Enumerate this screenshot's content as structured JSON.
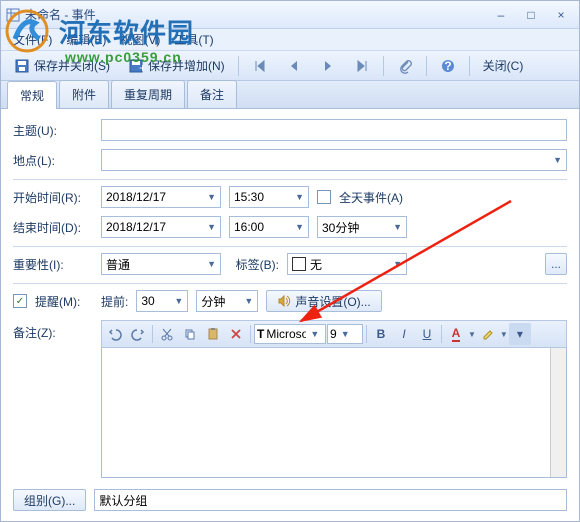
{
  "window": {
    "title": "未命名 - 事件"
  },
  "winbtns": {
    "min": "–",
    "max": "□",
    "close": "×"
  },
  "menu": {
    "file": "文件(F)",
    "edit": "编辑(E)",
    "view": "视图(V)",
    "tools": "工具(T)"
  },
  "toolbar": {
    "save_close": "保存并关闭(S)",
    "save_add": "保存并增加(N)",
    "close": "关闭(C)"
  },
  "tabs": {
    "general": "常规",
    "attach": "附件",
    "recur": "重复周期",
    "note": "备注"
  },
  "labels": {
    "subject": "主题(U):",
    "location": "地点(L):",
    "start": "开始时间(R):",
    "end": "结束时间(D):",
    "importance": "重要性(I):",
    "tag": "标签(B):",
    "remind": "提醒(M):",
    "before": "提前:",
    "memo": "备注(Z):",
    "allday": "全天事件(A)",
    "sound": "声音设置(O)...",
    "group": "组别(G)..."
  },
  "values": {
    "subject": "",
    "location": "",
    "start_date": "2018/12/17",
    "start_time": "15:30",
    "end_date": "2018/12/17",
    "end_time": "16:00",
    "duration": "30分钟",
    "importance": "普通",
    "tag": "无",
    "tag_color": "#ffffff",
    "remind_checked": true,
    "remind_num": "30",
    "remind_unit": "分钟",
    "font": "Microsoft",
    "fontsize": "9",
    "group_value": "默认分组"
  },
  "rte": {
    "bold": "B",
    "italic": "I",
    "underline": "U"
  },
  "watermark": {
    "brand": "河东软件园",
    "url": "www.pc0359.cn"
  }
}
